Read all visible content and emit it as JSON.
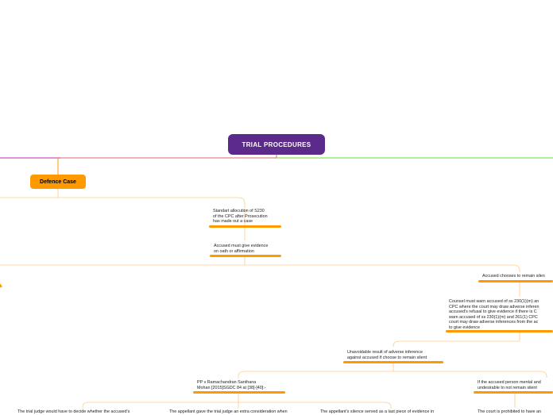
{
  "map": {
    "root": "TRIAL PROCEDURES",
    "defence_case": "Defence Case",
    "nodes": {
      "standard_allocution": "Standart allocution of S230\nof the CPC after Prosecution\nhas made out a case",
      "accused_evidence": "Accused must give evidence\non oath or affirmation",
      "remain_silent": "Accused chooses to remain silen",
      "counsel_warn": "Counsel must warn accused of ss 230(1)(m) an\nCPC where the court may draw adverse inferen\naccused's refusal to give evidence if there is C\nwarn accused of ss 230(1)(m) and 261(1) CPC\ncourt may draw adverse inferences from the ac\nto give evidence",
      "unavoidable_inference": "Unavoidable result of adverse inference\nagainst accused if choose to remain silent",
      "pp_case": "PP v Ramachandran Santhana\nMohan [2015]SGDC 84 at [38]-[40]:-",
      "mental_condition": "If the accused person mental and\nundesirable to not remain silent",
      "trial_judge_decide": "The trial judge would have to decide whether the accused's",
      "appellant_gave": "The appellant gave the trial judge an extra consideration when",
      "appellant_silence": "The appellant's silence served as a last piece of evidence in",
      "court_prohibited": "The court is prohibited to have an"
    }
  },
  "colors": {
    "root": "#5b2a8a",
    "main_topic": "#ff9900",
    "branch_magenta": "#b02cb0",
    "branch_green": "#66dd33",
    "connector": "#ffcc88"
  }
}
